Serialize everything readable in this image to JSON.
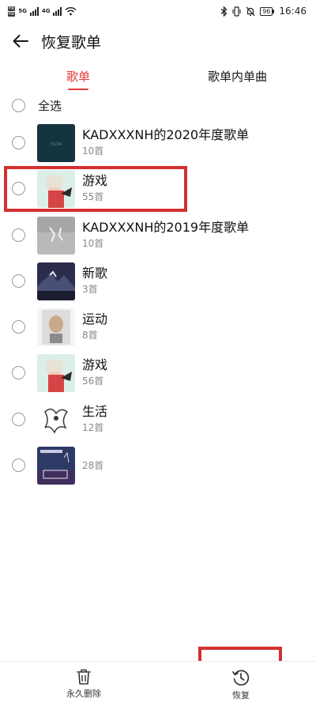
{
  "status_bar": {
    "sim1": "HD",
    "sim2": "HD",
    "signal1": "5G",
    "signal2": "4G",
    "battery": "96",
    "time": "16:46"
  },
  "header": {
    "title": "恢复歌单",
    "back_icon": "arrow-left-icon"
  },
  "tabs": [
    {
      "label": "歌单",
      "active": true
    },
    {
      "label": "歌单内单曲",
      "active": false
    }
  ],
  "select_all_label": "全选",
  "playlists": [
    {
      "title": "KADXXXNH的2020年度歌单",
      "count": "10首"
    },
    {
      "title": "游戏",
      "count": "55首"
    },
    {
      "title": "KADXXXNH的2019年度歌单",
      "count": "10首"
    },
    {
      "title": "新歌",
      "count": "3首"
    },
    {
      "title": "运动",
      "count": "8首"
    },
    {
      "title": "游戏",
      "count": "56首"
    },
    {
      "title": "生活",
      "count": "12首"
    },
    {
      "title": "",
      "count": "28首"
    }
  ],
  "bottom_bar": {
    "delete_label": "永久删除",
    "restore_label": "恢复"
  },
  "colors": {
    "accent": "#e53935",
    "highlight_box": "#d32f2f"
  }
}
